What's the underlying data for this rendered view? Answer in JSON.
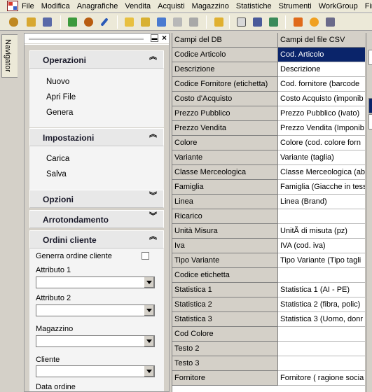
{
  "menu": [
    "File",
    "Modifica",
    "Anagrafiche",
    "Vendita",
    "Acquisti",
    "Magazzino",
    "Statistiche",
    "Strumenti",
    "WorkGroup",
    "Fines"
  ],
  "navigator_tab": "Navigator",
  "sections": {
    "operazioni": {
      "title": "Operazioni",
      "links": [
        "Nuovo",
        "Apri File",
        "Genera"
      ]
    },
    "impostazioni": {
      "title": "Impostazioni",
      "links": [
        "Carica",
        "Salva"
      ]
    },
    "opzioni": {
      "title": "Opzioni"
    },
    "arrotondamento": {
      "title": "Arrotondamento"
    },
    "ordini": {
      "title": "Ordini cliente",
      "genera_label": "Generra ordine cliente",
      "fields": [
        "Attributo 1",
        "Attributo 2",
        "Magazzino",
        "Cliente",
        "Data ordine"
      ]
    }
  },
  "grid": {
    "header": [
      "Campi del DB",
      "Campi del file CSV"
    ],
    "rows": [
      [
        "Codice Articolo",
        "Cod. Articolo"
      ],
      [
        "Descrizione",
        "Descrizione"
      ],
      [
        "Codice Fornitore (etichetta)",
        "Cod. fornitore (barcode"
      ],
      [
        "Costo d'Acquisto",
        "Costo Acquisto (imponib"
      ],
      [
        "Prezzo Pubblico",
        "Prezzo Pubblico (ivato)"
      ],
      [
        "Prezzo Vendita",
        "Prezzo Vendita (Imponib"
      ],
      [
        "Colore",
        "Colore (cod. colore forn"
      ],
      [
        "Variante",
        "Variante (taglia)"
      ],
      [
        "Classe Merceologica",
        "Classe Merceologica (ab"
      ],
      [
        "Famiglia",
        "Famiglia (Giacche in tess"
      ],
      [
        "Linea",
        "Linea (Brand)"
      ],
      [
        "Ricarico",
        ""
      ],
      [
        "Unità Misura",
        "UnitÃ  di misuta (pz)"
      ],
      [
        "Iva",
        "IVA (cod. iva)"
      ],
      [
        "Tipo Variante",
        "Tipo Variante (Tipo tagli"
      ],
      [
        "Codice etichetta",
        ""
      ],
      [
        "Statistica 1",
        "Statistica 1 (AI - PE)"
      ],
      [
        "Statistica 2",
        "Statistica 2 (fibra, polic)"
      ],
      [
        "Statistica 3",
        "Statistica 3 (Uomo, donr"
      ],
      [
        "Cod Colore",
        ""
      ],
      [
        "Testo 2",
        ""
      ],
      [
        "Testo 3",
        ""
      ],
      [
        "Fornitore",
        "Fornitore ( ragione socia"
      ]
    ]
  },
  "right_strip": [
    "C",
    "L",
    "U"
  ],
  "colors": {
    "selection": "#0a246a",
    "panel": "#d4d0c8"
  }
}
